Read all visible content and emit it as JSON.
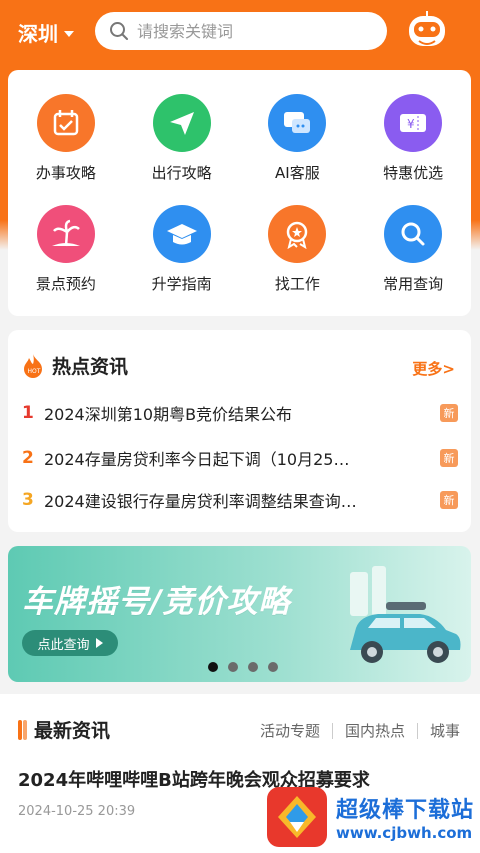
{
  "header": {
    "city": "深圳",
    "search_placeholder": "请搜索关键词"
  },
  "services": [
    {
      "label": "办事攻略",
      "icon": "calendar-icon",
      "color": "#f8762a"
    },
    {
      "label": "出行攻略",
      "icon": "send-icon",
      "color": "#2ec26b"
    },
    {
      "label": "AI客服",
      "icon": "chat-icon",
      "color": "#2f8ff0"
    },
    {
      "label": "特惠优选",
      "icon": "coupon-icon",
      "color": "#8a5cf0"
    },
    {
      "label": "景点预约",
      "icon": "palm-tree-icon",
      "color": "#f04f7a"
    },
    {
      "label": "升学指南",
      "icon": "graduation-cap-icon",
      "color": "#2f8ff0"
    },
    {
      "label": "找工作",
      "icon": "medal-icon",
      "color": "#f8762a"
    },
    {
      "label": "常用查询",
      "icon": "search-icon",
      "color": "#2f8ff0"
    }
  ],
  "hot_news": {
    "title": "热点资讯",
    "more": "更多>",
    "items": [
      {
        "rank": "1",
        "text": "2024深圳第10期粤B竞价结果公布",
        "badge": "新",
        "rank_color": "#e63a2e"
      },
      {
        "rank": "2",
        "text": "2024存量房贷利率今日起下调（10月25…",
        "badge": "新",
        "rank_color": "#f87216"
      },
      {
        "rank": "3",
        "text": "2024建设银行存量房贷利率调整结果查询…",
        "badge": "新",
        "rank_color": "#f5a623"
      }
    ]
  },
  "banner": {
    "title": "车牌摇号/竞价攻略",
    "button": "点此查询",
    "active_index": 0,
    "dot_count": 4
  },
  "latest": {
    "title": "最新资讯",
    "tabs": [
      "活动专题",
      "国内热点",
      "城事"
    ],
    "article_title": "2024年哔哩哔哩B站跨年晚会观众招募要求",
    "article_time": "2024-10-25 20:39"
  },
  "watermark": {
    "name": "超级棒下载站",
    "url": "www.cjbwh.com"
  }
}
